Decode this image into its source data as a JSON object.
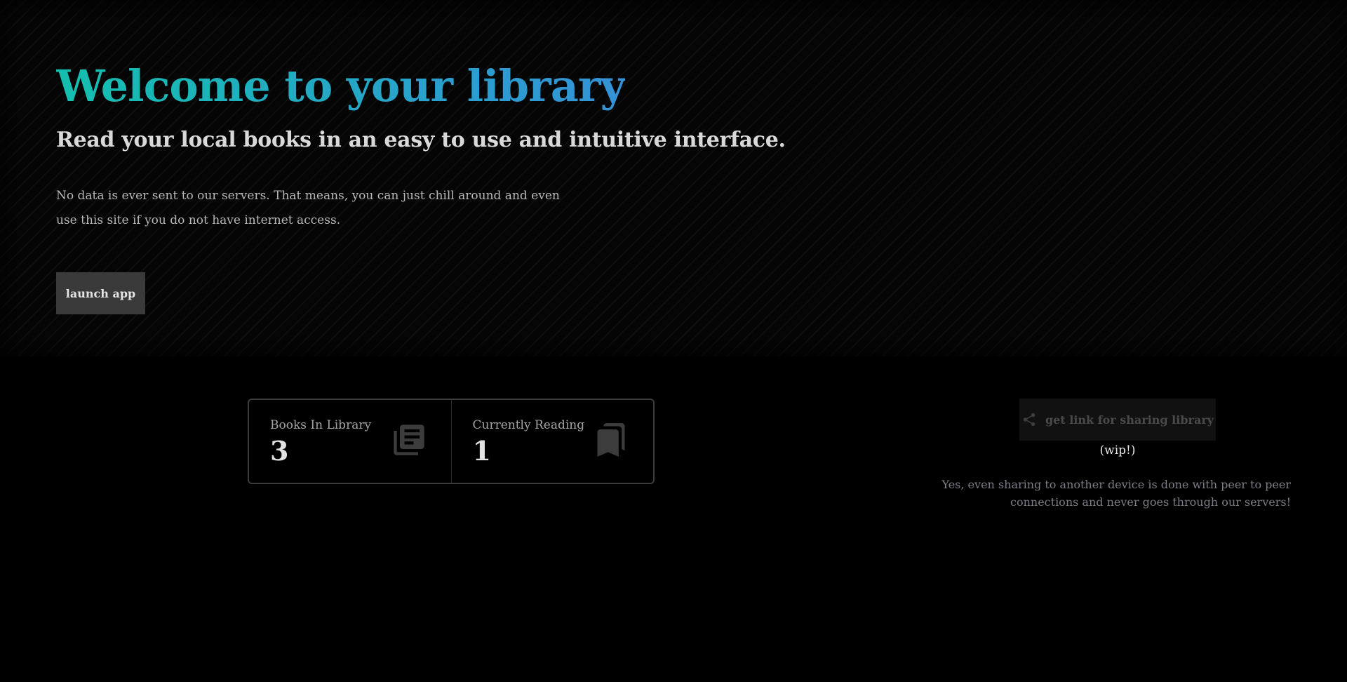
{
  "hero": {
    "title": "Welcome to your library",
    "subtitle": "Read your local books in an easy to use and intuitive interface.",
    "description": "No data is ever sent to our servers. That means, you can just chill around and even use this site if you do not have internet access.",
    "launch_label": "launch app",
    "title_gradient": [
      "#14bfae",
      "#3492d6"
    ]
  },
  "stats": [
    {
      "label": "Books In Library",
      "value": "3",
      "icon": "library-books-icon"
    },
    {
      "label": "Currently Reading",
      "value": "1",
      "icon": "bookmarks-icon"
    }
  ],
  "share": {
    "button_label": "get link for sharing library",
    "icon": "share-icon",
    "wip_label": "(wip!)",
    "note": "Yes, even sharing to another device is done with peer to peer connections and never goes through our servers!"
  }
}
